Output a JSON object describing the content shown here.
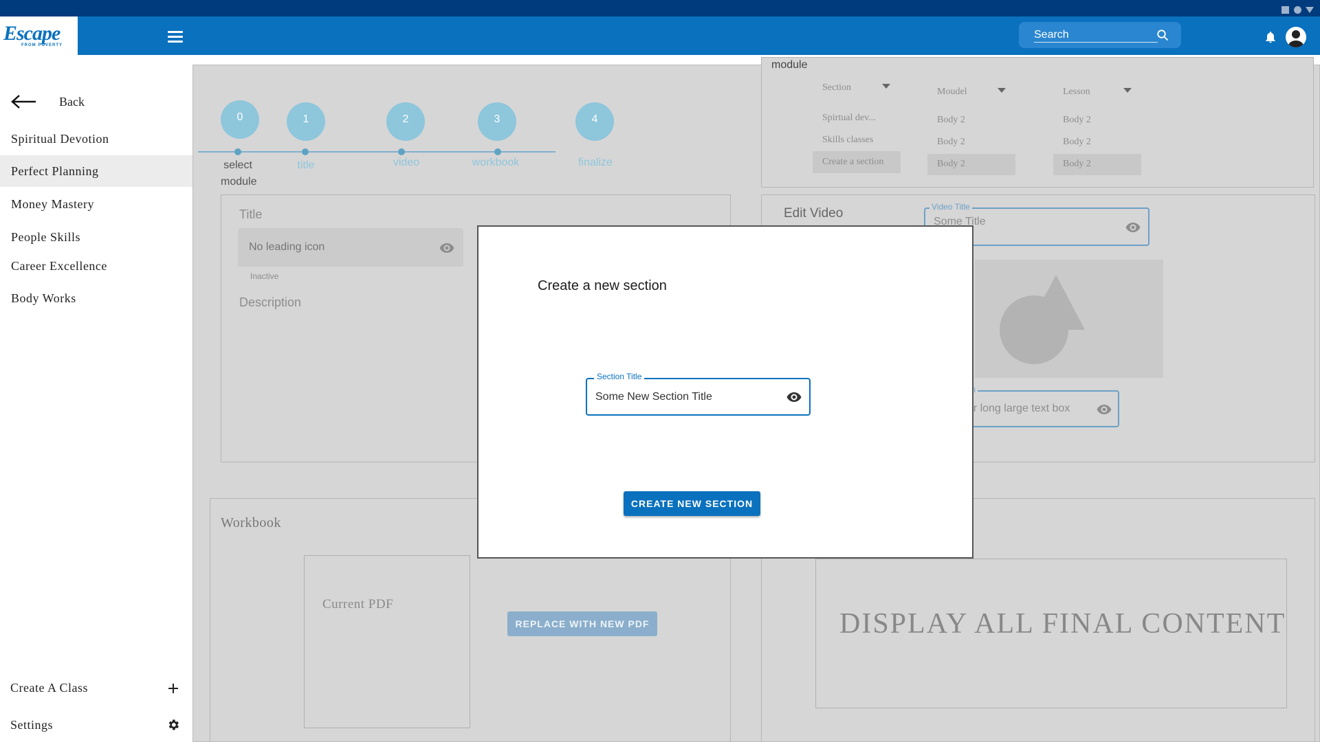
{
  "header": {
    "logo_text": "Escape",
    "logo_subtext": "FROM POVERTY",
    "search_placeholder": "Search"
  },
  "sidebar": {
    "back_label": "Back",
    "items": [
      {
        "label": "Spiritual Devotion"
      },
      {
        "label": "Perfect Planning"
      },
      {
        "label": "Money Mastery"
      },
      {
        "label": "People Skills"
      },
      {
        "label": "Career Excellence"
      },
      {
        "label": "Body Works"
      }
    ],
    "create_class_label": "Create A Class",
    "settings_label": "Settings"
  },
  "stepper": {
    "steps": [
      {
        "number": "0",
        "label": "select module"
      },
      {
        "number": "1",
        "label": "title"
      },
      {
        "number": "2",
        "label": "video"
      },
      {
        "number": "3",
        "label": "workbook"
      },
      {
        "number": "4",
        "label": "finalize"
      }
    ]
  },
  "module_panel": {
    "title": "module",
    "section_dropdown": "Section",
    "moudel_dropdown": "Moudel",
    "lesson_dropdown": "Lesson",
    "section_items": [
      "Spirtual dev...",
      "Skills classes",
      "Create a section"
    ],
    "moudel_items": [
      "Body 2",
      "Body 2",
      "Body 2"
    ],
    "lesson_items": [
      "Body 2",
      "Body 2",
      "Body 2"
    ]
  },
  "title_panel": {
    "title_label": "Title",
    "title_placeholder": "No leading icon",
    "title_helper": "Inactive",
    "description_label": "Description"
  },
  "video_panel": {
    "heading": "Edit Video",
    "video_title_label": "Video Title",
    "video_title_value": "Some Title",
    "description_label_partial": "ption",
    "description_value_partial": "per long large text box"
  },
  "workbook_panel": {
    "heading": "Workbook",
    "current_pdf_label": "Current PDF",
    "replace_button": "REPLACE WITH NEW PDF"
  },
  "final_panel": {
    "text": "DISPLAY ALL FINAL CONTENT"
  },
  "dialog": {
    "title": "Create a new section",
    "field_label": "Section Title",
    "field_value": "Some New Section Title",
    "button_label": "CREATE NEW SECTION"
  },
  "colors": {
    "brand_blue": "#0a71be",
    "sysbar_navy": "#003b7d",
    "step_teal": "#8ec6dc"
  }
}
